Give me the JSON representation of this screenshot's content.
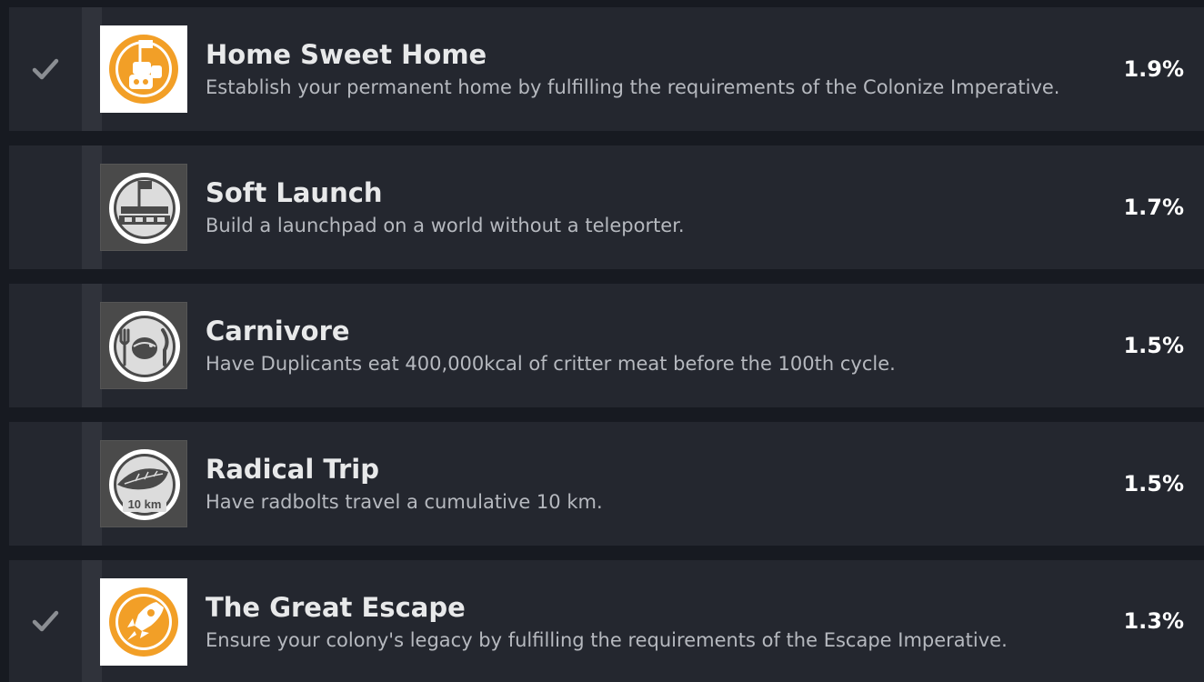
{
  "achievements": [
    {
      "title": "Home Sweet Home",
      "description": "Establish your permanent home by fulfilling the requirements of the Colonize Imperative.",
      "percent": "1.9%",
      "unlocked": true,
      "icon": "colony-flag-icon"
    },
    {
      "title": "Soft Launch",
      "description": "Build a launchpad on a world without a teleporter.",
      "percent": "1.7%",
      "unlocked": false,
      "icon": "launchpad-flag-icon"
    },
    {
      "title": "Carnivore",
      "description": "Have Duplicants eat 400,000kcal of critter meat before the 100th cycle.",
      "percent": "1.5%",
      "unlocked": false,
      "icon": "critter-meal-icon"
    },
    {
      "title": "Radical Trip",
      "description": "Have radbolts travel a cumulative 10 km.",
      "percent": "1.5%",
      "unlocked": false,
      "icon": "radbolt-icon",
      "icon_text": "10 km"
    },
    {
      "title": "The Great Escape",
      "description": "Ensure your colony's legacy by fulfilling the requirements of the Escape Imperative.",
      "percent": "1.3%",
      "unlocked": true,
      "icon": "rocket-icon"
    }
  ],
  "colors": {
    "background": "#171a21",
    "row": "#24272f",
    "achieved_orange": "#f29f27",
    "locked_gray": "#4a4a4a"
  }
}
